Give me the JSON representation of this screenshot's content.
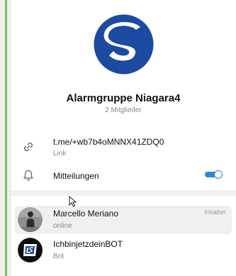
{
  "group": {
    "title": "Alarmgruppe Niagara4",
    "subtitle": "2 Mitglieder"
  },
  "info": {
    "link_value": "t.me/+wb7b4oMNNX41ZDQ0",
    "link_label": "Link",
    "notifications_label": "Mitteilungen",
    "notifications_enabled": true
  },
  "members": [
    {
      "name": "Marcello Meriano",
      "status": "online",
      "role": "Inhaber"
    },
    {
      "name": "IchbinjetzdeinBOT",
      "status": "Bot",
      "role": ""
    }
  ],
  "colors": {
    "accent": "#2e88d6",
    "logo_blue": "#1b4aa0"
  },
  "icons": {
    "link": "link-icon",
    "bell": "bell-icon"
  }
}
